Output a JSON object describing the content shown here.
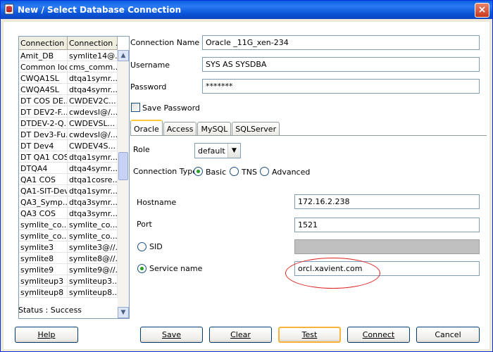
{
  "window": {
    "title": "New / Select Database Connection",
    "close_glyph": "×"
  },
  "list": {
    "headers": [
      "Connection ...",
      "Connection ..."
    ],
    "rows": [
      [
        "Amit_DB",
        "symlite14@..."
      ],
      [
        "Common local",
        "cms_comm..."
      ],
      [
        "CWQA1SL",
        "dtqa1symr..."
      ],
      [
        "CWQA4SL",
        "dtqa4symr..."
      ],
      [
        "DT COS DE...",
        "CWDEV2C..."
      ],
      [
        "DT DEV2-F...",
        "cwdevsl@/..."
      ],
      [
        "DTDEV-2-Q...",
        "CWDEVSL..."
      ],
      [
        "DT Dev3-Fu...",
        "cwdevsl@/..."
      ],
      [
        "DT Dev4",
        "CWDEV4S..."
      ],
      [
        "DT QA1 COS",
        "dtqa1symr..."
      ],
      [
        "DTQA4",
        "dtqa4symr..."
      ],
      [
        "QA1 COS",
        "dtqa1cosre..."
      ],
      [
        "QA1-SIT-Dev",
        "dtqa1symr..."
      ],
      [
        "QA3_Symp...",
        "dtqa3symr..."
      ],
      [
        "QA3 COS",
        "dtqa3symr..."
      ],
      [
        "symlite_co...",
        "symlite_co..."
      ],
      [
        "symlite_co...",
        "symlite_co..."
      ],
      [
        "symlite3",
        "symlite3@//..."
      ],
      [
        "symlite8",
        "symlite8@//..."
      ],
      [
        "symlite9",
        "symlite9@//..."
      ],
      [
        "symliteup3",
        "symliteup3..."
      ],
      [
        "symliteup8",
        "symliteup8..."
      ]
    ],
    "scroll_up": "▲",
    "scroll_down": "▼"
  },
  "status": "Status : Success",
  "form": {
    "connection_name_label": "Connection Name",
    "connection_name": "Oracle _11G_xen-234",
    "username_label": "Username",
    "username": "SYS AS SYSDBA",
    "password_label": "Password",
    "password": "*******",
    "save_password_label": "Save Password"
  },
  "tabs": [
    "Oracle",
    "Access",
    "MySQL",
    "SQLServer"
  ],
  "oracle": {
    "role_label": "Role",
    "role_value": "default",
    "role_arrow": "▼",
    "conn_type_label": "Connection Type",
    "conn_type_options": [
      "Basic",
      "TNS",
      "Advanced"
    ],
    "hostname_label": "Hostname",
    "hostname": "172.16.2.238",
    "port_label": "Port",
    "port": "1521",
    "sid_label": "SID",
    "sid": "",
    "service_name_label": "Service name",
    "service_name": "orcl.xavient.com"
  },
  "buttons": {
    "help": "Help",
    "save": "Save",
    "clear": "Clear",
    "test": "Test",
    "connect": "Connect",
    "cancel": "Cancel"
  },
  "colors": {
    "title_bar": "#0a5fe0",
    "highlight_ellipse": "#e02020",
    "default_button_border": "#f8b33b"
  }
}
